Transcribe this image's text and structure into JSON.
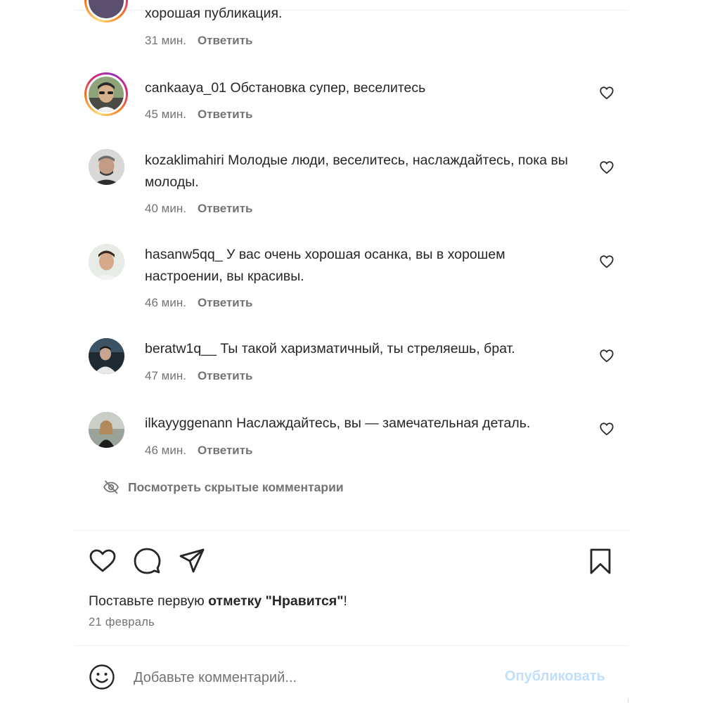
{
  "comments": [
    {
      "username": "",
      "text": "хорошая публикация.",
      "time": "31 мин.",
      "reply_label": "Ответить"
    },
    {
      "username": "cankaaya_01",
      "text": "Обстановка супер, веселитесь",
      "time": "45 мин.",
      "reply_label": "Ответить"
    },
    {
      "username": "kozaklimahiri",
      "text": "Молодые люди, веселитесь, наслаждайтесь, пока вы молоды.",
      "time": "40 мин.",
      "reply_label": "Ответить"
    },
    {
      "username": "hasanw5qq_",
      "text": "У вас очень хорошая осанка, вы в хорошем настроении, вы красивы.",
      "time": "46 мин.",
      "reply_label": "Ответить"
    },
    {
      "username": "beratw1q__",
      "text": "Ты такой харизматичный, ты стреляешь, брат.",
      "time": "47 мин.",
      "reply_label": "Ответить"
    },
    {
      "username": "ilkayyggenann",
      "text": "Наслаждайтесь, вы — замечательная деталь.",
      "time": "46 мин.",
      "reply_label": "Ответить"
    }
  ],
  "hidden_comments_label": "Посмотреть скрытые комментарии",
  "likes": {
    "prefix": "Поставьте первую ",
    "bold": "отметку \"Нравится\"",
    "suffix": "!"
  },
  "date": "21 февраль",
  "composer": {
    "placeholder": "Добавьте комментарий...",
    "publish_label": "Опубликовать"
  },
  "colors": {
    "text": "#262626",
    "secondary": "#737373",
    "publish_disabled": "#c0dffd",
    "divider": "#efefef"
  },
  "icons": {
    "like": "heart-icon",
    "comment": "comment-bubble-icon",
    "share": "paper-plane-icon",
    "save": "bookmark-icon",
    "emoji": "smiley-icon",
    "hidden": "eye-slash-icon"
  }
}
